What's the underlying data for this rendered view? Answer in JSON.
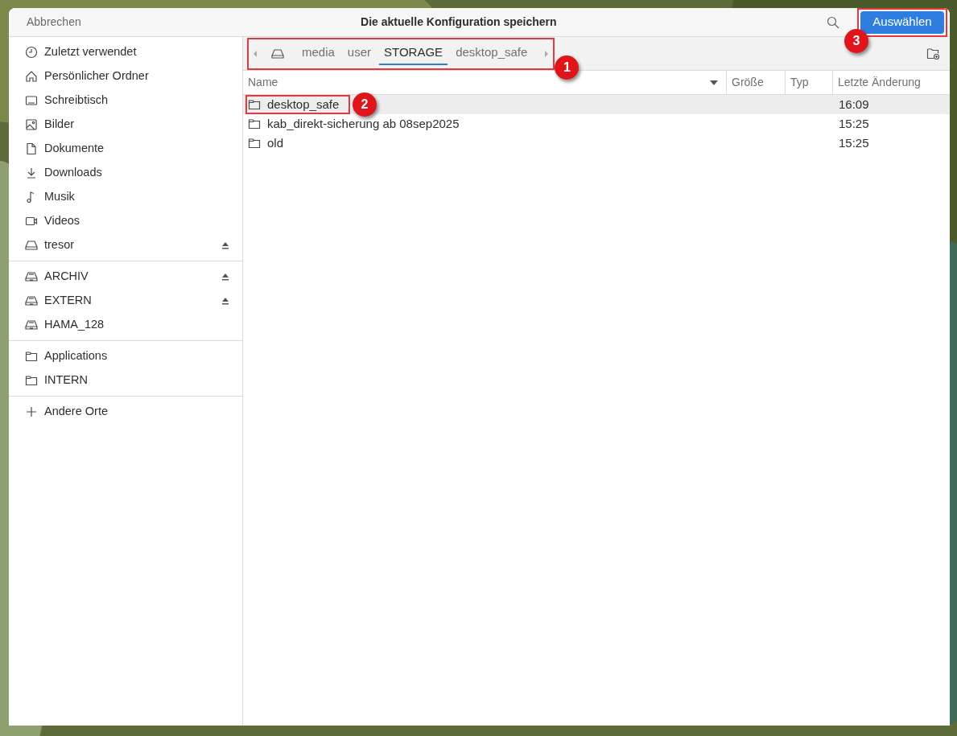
{
  "header": {
    "cancel": "Abbrechen",
    "title": "Die aktuelle Konfiguration speichern",
    "confirm": "Auswählen"
  },
  "sidebar": {
    "groups": [
      [
        {
          "label": "Zuletzt verwendet",
          "kind": "recent",
          "eject": false
        },
        {
          "label": "Persönlicher Ordner",
          "kind": "home",
          "eject": false
        },
        {
          "label": "Schreibtisch",
          "kind": "desktop",
          "eject": false
        },
        {
          "label": "Bilder",
          "kind": "pictures",
          "eject": false
        },
        {
          "label": "Dokumente",
          "kind": "documents",
          "eject": false
        },
        {
          "label": "Downloads",
          "kind": "downloads",
          "eject": false
        },
        {
          "label": "Musik",
          "kind": "music",
          "eject": false
        },
        {
          "label": "Videos",
          "kind": "videos",
          "eject": false
        },
        {
          "label": "tresor",
          "kind": "drive",
          "eject": true
        }
      ],
      [
        {
          "label": "ARCHIV",
          "kind": "usb",
          "eject": true
        },
        {
          "label": "EXTERN",
          "kind": "usb",
          "eject": true
        },
        {
          "label": "HAMA_128",
          "kind": "usb",
          "eject": false
        }
      ],
      [
        {
          "label": "Applications",
          "kind": "folder",
          "eject": false
        },
        {
          "label": "INTERN",
          "kind": "folder",
          "eject": false
        }
      ],
      [
        {
          "label": "Andere Orte",
          "kind": "other",
          "eject": false
        }
      ]
    ]
  },
  "path_bar": {
    "segments": [
      {
        "label": "media",
        "selected": false
      },
      {
        "label": "user",
        "selected": false
      },
      {
        "label": "STORAGE",
        "selected": true
      },
      {
        "label": "desktop_safe",
        "selected": false
      }
    ]
  },
  "table": {
    "columns": [
      "Name",
      "Größe",
      "Typ",
      "Letzte Änderung"
    ],
    "rows": [
      {
        "name": "desktop_safe",
        "modified": "16:09",
        "selected": true
      },
      {
        "name": "kab_direkt-sicherung ab 08sep2025",
        "modified": "15:25",
        "selected": false
      },
      {
        "name": "old",
        "modified": "15:25",
        "selected": false
      }
    ]
  },
  "callouts": [
    "1",
    "2",
    "3"
  ]
}
